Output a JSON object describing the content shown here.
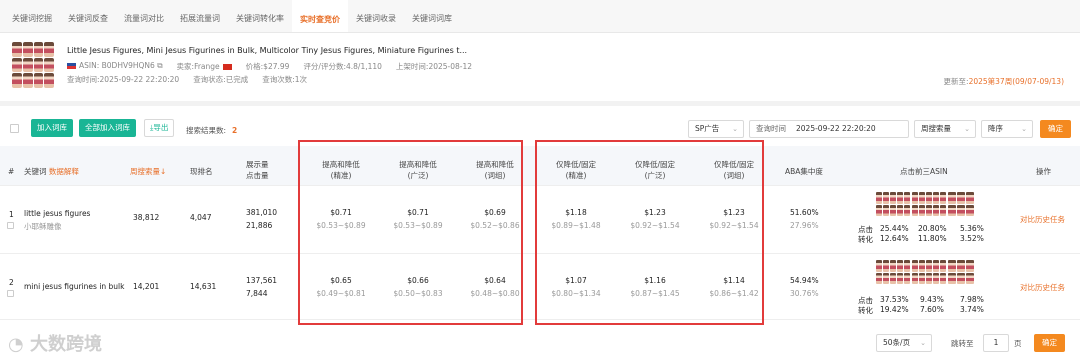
{
  "tabs": [
    "关键词挖掘",
    "关键词反查",
    "流量词对比",
    "拓展流量词",
    "关键词转化率",
    "实时查竞价",
    "关键词收录",
    "关键词词库"
  ],
  "active_tab_index": 5,
  "product": {
    "title": "Little Jesus Figures, Mini Jesus Figurines in Bulk, Multicolor Tiny Jesus Figures, Miniature Figurines t...",
    "asin": "ASIN: B0DHV9HQN6",
    "seller": "卖家:Frange",
    "price": "价格:$27.99",
    "rating": "评分/评分数:4.8/1,110",
    "launch": "上架时间:2025-08-12",
    "query_time": "查询时间:2025-09-22 22:20:20",
    "query_status": "查询状态:已完成",
    "query_count": "查询次数:1次",
    "update_prefix": "更新至:",
    "update_value": "2025第37周(09/07-09/13)"
  },
  "toolbar": {
    "add_label": "加入词库",
    "add_all_label": "全部加入词库",
    "export_label": "导出",
    "result_label": "搜索结果数:",
    "result_count": "2",
    "ad_type": "SP广告",
    "query_time_label": "查询时间",
    "query_time_value": "2025-09-22 22:20:20",
    "sort_field": "周搜索量",
    "sort_order": "降序",
    "confirm": "确定"
  },
  "headers": {
    "index": "#",
    "keyword": "关键词",
    "keyword_extra": "数据解释",
    "search_volume": "周搜索量↓",
    "rank": "现排名",
    "impr_1": "展示量",
    "impr_2": "点击量",
    "bid_up_exact_1": "提高和降低",
    "bid_up_exact_2": "(精准)",
    "bid_up_broad_1": "提高和降低",
    "bid_up_broad_2": "(广泛)",
    "bid_up_phrase_1": "提高和降低",
    "bid_up_phrase_2": "(词组)",
    "bid_down_exact_1": "仅降低/固定",
    "bid_down_exact_2": "(精准)",
    "bid_down_broad_1": "仅降低/固定",
    "bid_down_broad_2": "(广泛)",
    "bid_down_phrase_1": "仅降低/固定",
    "bid_down_phrase_2": "(词组)",
    "aba": "ABA集中度",
    "top3": "点击前三ASIN",
    "ops": "操作"
  },
  "rows": [
    {
      "index": "1",
      "keyword": "little jesus figures",
      "keyword_cn": "小耶稣雕像",
      "search_volume": "38,812",
      "rank": "4,047",
      "impressions": "381,010",
      "clicks": "21,886",
      "up_exact": "$0.71",
      "up_exact_range": "$0.53~$0.89",
      "up_broad": "$0.71",
      "up_broad_range": "$0.53~$0.89",
      "up_phrase": "$0.69",
      "up_phrase_range": "$0.52~$0.86",
      "down_exact": "$1.18",
      "down_exact_range": "$0.89~$1.48",
      "down_broad": "$1.23",
      "down_broad_range": "$0.92~$1.54",
      "down_phrase": "$1.23",
      "down_phrase_range": "$0.92~$1.54",
      "aba_click": "51.60%",
      "aba_conv": "27.96%",
      "click_label": "点击",
      "conv_label": "转化",
      "top_click": [
        "25.44%",
        "20.80%",
        "5.36%"
      ],
      "top_conv": [
        "12.64%",
        "11.80%",
        "3.52%"
      ],
      "action": "对比历史任务"
    },
    {
      "index": "2",
      "keyword": "mini jesus figurines in bulk",
      "keyword_cn": "",
      "search_volume": "14,201",
      "rank": "14,631",
      "impressions": "137,561",
      "clicks": "7,844",
      "up_exact": "$0.65",
      "up_exact_range": "$0.49~$0.81",
      "up_broad": "$0.66",
      "up_broad_range": "$0.50~$0.83",
      "up_phrase": "$0.64",
      "up_phrase_range": "$0.48~$0.80",
      "down_exact": "$1.07",
      "down_exact_range": "$0.80~$1.34",
      "down_broad": "$1.16",
      "down_broad_range": "$0.87~$1.45",
      "down_phrase": "$1.14",
      "down_phrase_range": "$0.86~$1.42",
      "aba_click": "54.94%",
      "aba_conv": "30.76%",
      "click_label": "点击",
      "conv_label": "转化",
      "top_click": [
        "37.53%",
        "9.43%",
        "7.98%"
      ],
      "top_conv": [
        "19.42%",
        "7.60%",
        "3.74%"
      ],
      "action": "对比历史任务"
    }
  ],
  "footer": {
    "page_size": "50条/页",
    "jump_label": "跳转至",
    "page_value": "1",
    "page_unit": "页",
    "confirm": "确定",
    "watermark": "大数跨境"
  }
}
